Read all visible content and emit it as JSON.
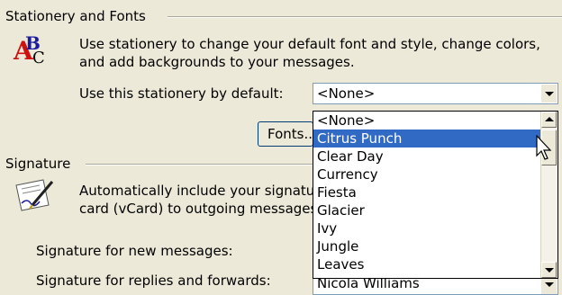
{
  "stationery": {
    "group_title": "Stationery and Fonts",
    "description_line1": "Use stationery to change your default font and style, change colors,",
    "description_line2": "and add backgrounds to your messages.",
    "default_label": "Use this stationery by default:",
    "default_value": "<None>",
    "fonts_button": "Fonts...",
    "options": [
      "<None>",
      "Citrus Punch",
      "Clear Day",
      "Currency",
      "Fiesta",
      "Glacier",
      "Ivy",
      "Jungle",
      "Leaves"
    ],
    "selected_index": 1
  },
  "signature": {
    "group_title": "Signature",
    "description_line1": "Automatically include your signature or attach your business",
    "description_line2": "card (vCard) to outgoing messages.",
    "new_messages_label": "Signature for new messages:",
    "replies_label": "Signature for replies and forwards:",
    "replies_value": "Nicola Williams"
  },
  "colors": {
    "highlight": "#316ac5",
    "dialog_bg": "#ece9d8"
  },
  "icons": {
    "stationery": "stationery-abc-icon",
    "signature": "signature-pen-icon",
    "cursor": "mouse-pointer-icon"
  }
}
